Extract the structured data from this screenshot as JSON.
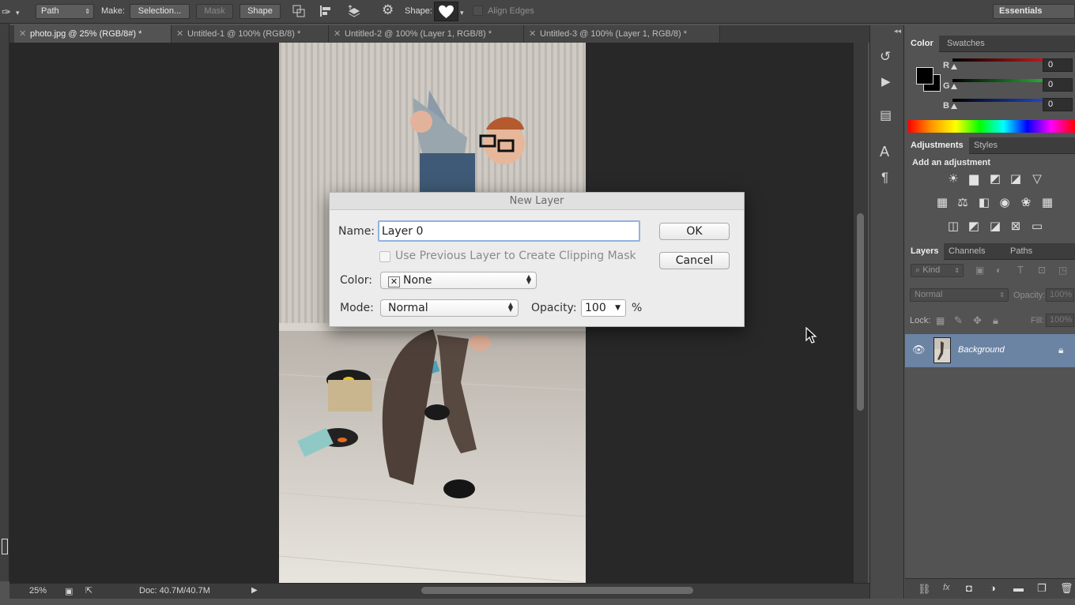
{
  "options_bar": {
    "path_mode": "Path",
    "make_label": "Make:",
    "selection_btn": "Selection...",
    "mask_btn": "Mask",
    "shape_btn": "Shape",
    "shape_label": "Shape:",
    "align_edges": "Align Edges",
    "workspace": "Essentials"
  },
  "tabs": [
    {
      "label": "photo.jpg @ 25% (RGB/8#) *",
      "active": true
    },
    {
      "label": "Untitled-1 @ 100% (RGB/8) *",
      "active": false
    },
    {
      "label": "Untitled-2 @ 100% (Layer 1, RGB/8) *",
      "active": false
    },
    {
      "label": "Untitled-3 @ 100% (Layer 1, RGB/8) *",
      "active": false
    }
  ],
  "status": {
    "zoom": "25%",
    "doc": "Doc: 40.7M/40.7M"
  },
  "color_panel": {
    "tabs": [
      "Color",
      "Swatches"
    ],
    "channels": [
      {
        "label": "R",
        "value": "0",
        "color": "#e23030"
      },
      {
        "label": "G",
        "value": "0",
        "color": "#2ecc40"
      },
      {
        "label": "B",
        "value": "0",
        "color": "#2f5fe6"
      }
    ]
  },
  "adjustments_panel": {
    "tabs": [
      "Adjustments",
      "Styles"
    ],
    "heading": "Add an adjustment"
  },
  "layers_panel": {
    "tabs": [
      "Layers",
      "Channels",
      "Paths"
    ],
    "kind": "Kind",
    "blend": "Normal",
    "opacity_label": "Opacity:",
    "opacity_value": "100%",
    "lock_label": "Lock:",
    "fill_label": "Fill:",
    "fill_value": "100%",
    "layers": [
      {
        "name": "Background",
        "visible": true,
        "locked": true
      }
    ]
  },
  "dialog": {
    "title": "New Layer",
    "name_label": "Name:",
    "name_value": "Layer 0",
    "clip_label": "Use Previous Layer to Create Clipping Mask",
    "clip_checked": false,
    "color_label": "Color:",
    "color_value": "None",
    "mode_label": "Mode:",
    "mode_value": "Normal",
    "opacity_label": "Opacity:",
    "opacity_value": "100",
    "percent": "%",
    "ok": "OK",
    "cancel": "Cancel"
  }
}
